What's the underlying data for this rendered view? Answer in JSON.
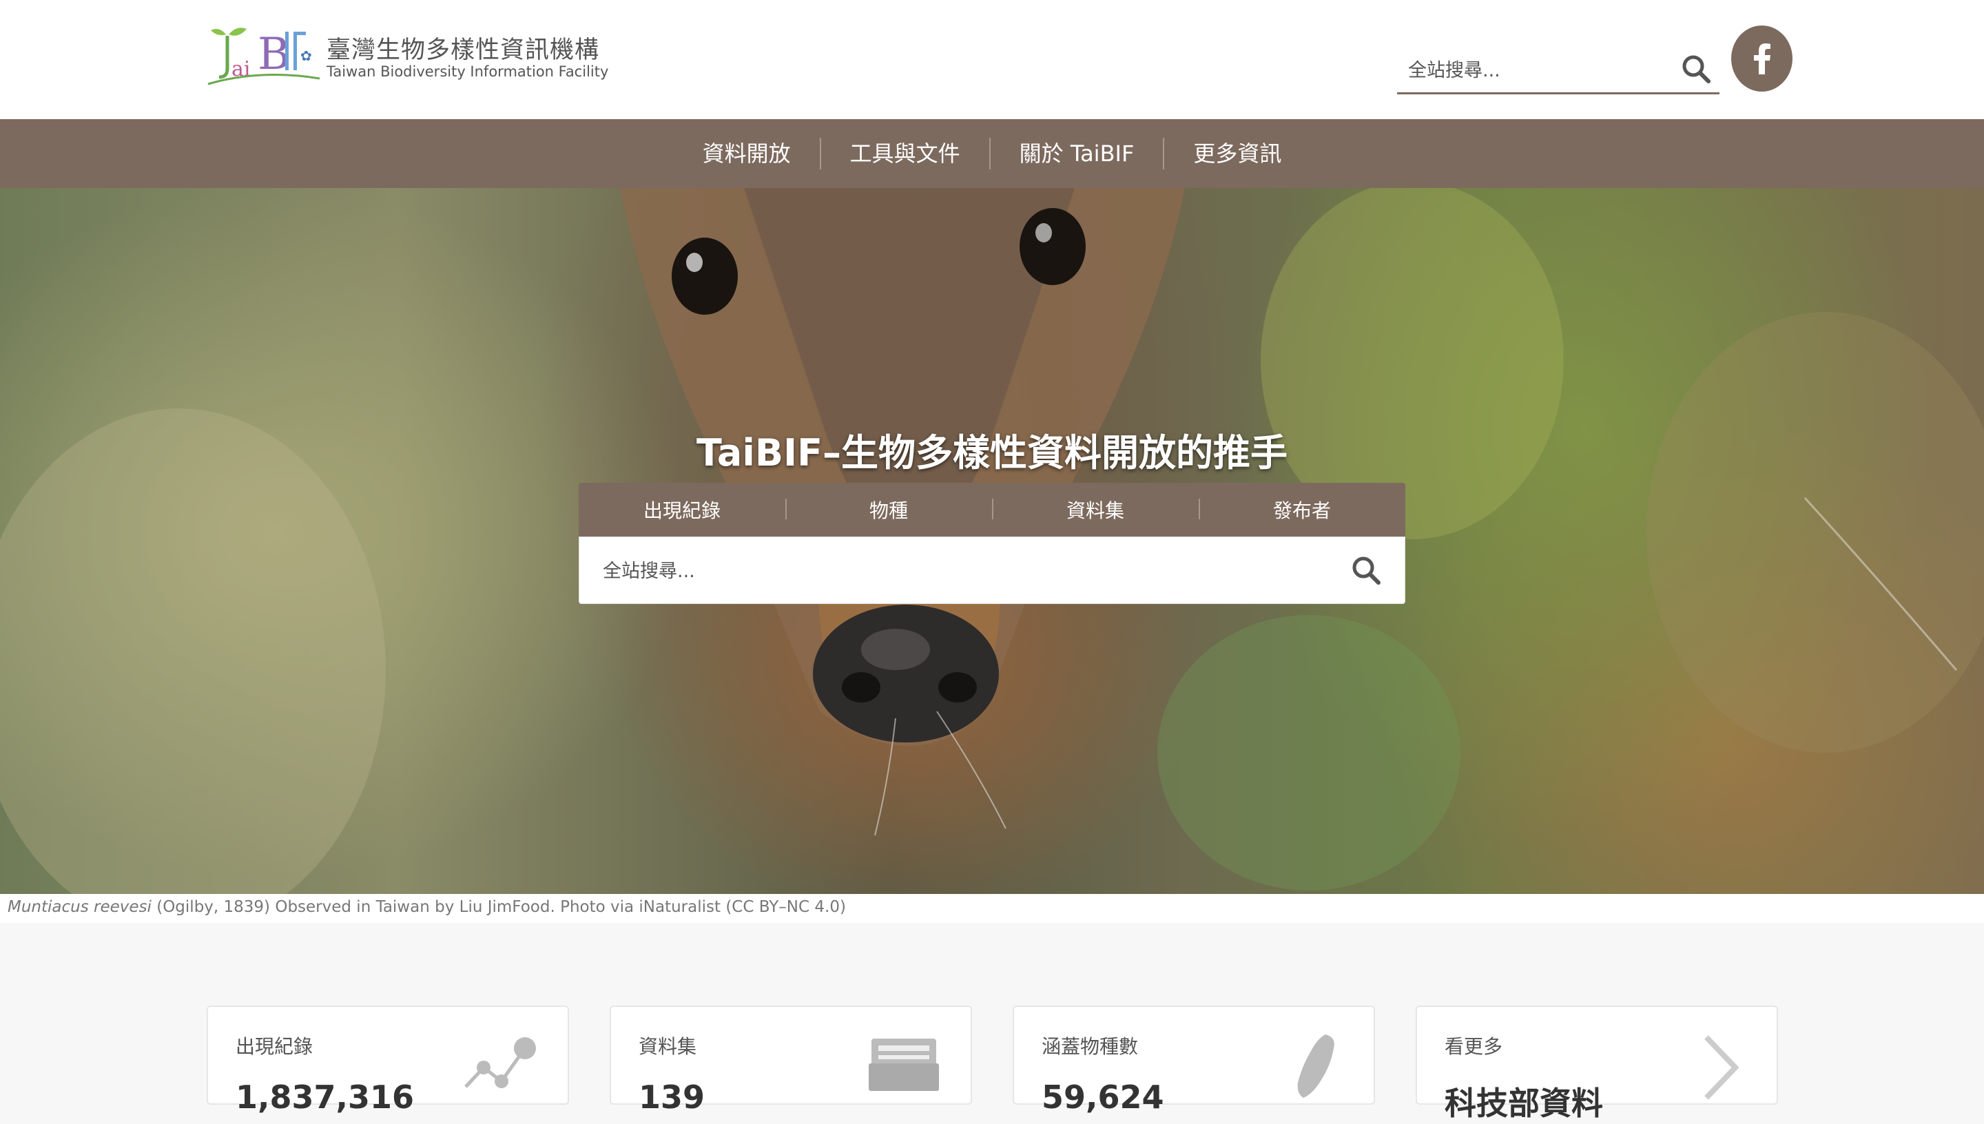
{
  "header": {
    "logo_zh": "臺灣生物多樣性資訊機構",
    "logo_en": "Taiwan Biodiversity Information Facility",
    "search_placeholder": "全站搜尋...",
    "search_icon": "search-icon",
    "facebook_icon": "facebook-icon"
  },
  "nav": {
    "items": [
      "資料開放",
      "工具與文件",
      "關於 TaiBIF",
      "更多資訊"
    ]
  },
  "hero": {
    "title": "TaiBIF–生物多樣性資料開放的推手",
    "tabs": [
      "出現紀錄",
      "物種",
      "資料集",
      "發布者"
    ],
    "search_placeholder": "全站搜尋...",
    "search_icon": "search-icon"
  },
  "caption": {
    "species": "Muntiacus reevesi",
    "text": " (Ogilby, 1839) Observed in Taiwan by Liu JimFood. Photo via iNaturalist (CC BY–NC 4.0)"
  },
  "cards": [
    {
      "title": "出現紀錄",
      "value": "1,837,316",
      "icon": "network-icon"
    },
    {
      "title": "資料集",
      "value": "139",
      "icon": "folder-icon"
    },
    {
      "title": "涵蓋物種數",
      "value": "59,624",
      "icon": "taiwan-map-icon"
    },
    {
      "title": "看更多",
      "value": "科技部資料",
      "icon": "chevron-right-icon"
    }
  ],
  "colors": {
    "brand": "#7d6a5e",
    "background": "#f7f7f7"
  }
}
